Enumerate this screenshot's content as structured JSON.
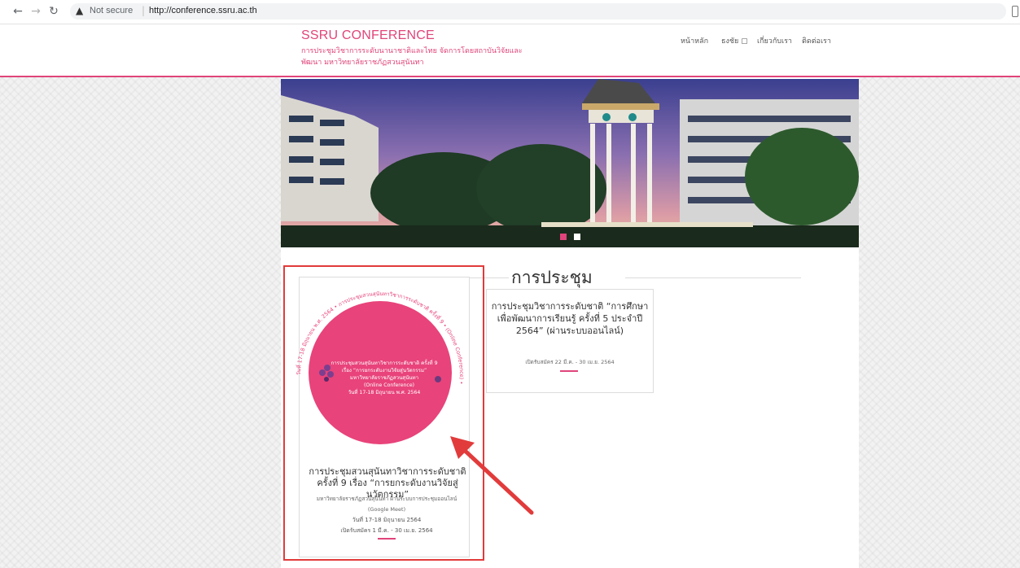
{
  "browser": {
    "security_label": "Not secure",
    "url": "http://conference.ssru.ac.th",
    "nav_back_icon": "arrow-left-icon",
    "nav_forward_icon": "arrow-right-icon",
    "reload_icon": "reload-icon"
  },
  "site": {
    "brand_title": "SSRU CONFERENCE",
    "brand_subtitle_line1": "การประชุมวิชาการระดับนานาชาติและไทย จัดการโดยสถาบันวิจัยและ",
    "brand_subtitle_line2": "พัฒนา มหาวิทยาลัยราชภัฏสวนสุนันทา",
    "nav": {
      "home": "หน้าหลัก",
      "field": "ธงชัย ▢",
      "about": "เกี่ยวกับเรา",
      "contact": "ติดต่อเรา"
    },
    "accent_color": "#e0447a"
  },
  "main": {
    "section_title": "การประชุม",
    "cards": [
      {
        "title": "การประชุมสวนสุนันทาวิชาการระดับชาติ ครั้งที่ 9 เรื่อง “การยกระดับงานวิจัยสู่นวัตกรรม”",
        "subtitle": "มหาวิทยาลัยราชภัฏสวนสุนันทา ผ่านระบบการประชุมออนไลน์",
        "meet": "(Google Meet)",
        "date": "วันที่ 17-18 มิถุนายน 2564",
        "registration": "เปิดรับสมัคร 1 มี.ค. - 30 เม.ย. 2564",
        "poster": {
          "ring_text": "วันที่ 17-18 มิถุนายน พ.ศ. 2564 • การประชุมสวนสุนันทาวิชาการระดับชาติ ครั้งที่ 9 • (Online Conference) •",
          "line1": "การประชุมสวนสุนันทาวิชาการระดับชาติ ครั้งที่ 9",
          "line2": "เรื่อง “การยกระดับงานวิจัยสู่นวัตกรรม”",
          "line3": "มหาวิทยาลัยราชภัฏสวนสุนันทา",
          "line4": "(Online Conference)",
          "line5": "วันที่ 17-18 มิถุนายน พ.ศ. 2564",
          "color": "#e8437a"
        }
      },
      {
        "title": "การประชุมวิชาการระดับชาติ “การศึกษาเพื่อพัฒนาการเรียนรู้ ครั้งที่ 5 ประจำปี 2564” (ผ่านระบบออนไลน์)",
        "registration": "เปิดรับสมัคร 22 มี.ค. - 30 เม.ย. 2564"
      }
    ]
  },
  "annotation": {
    "box_color": "#e23b3b"
  }
}
